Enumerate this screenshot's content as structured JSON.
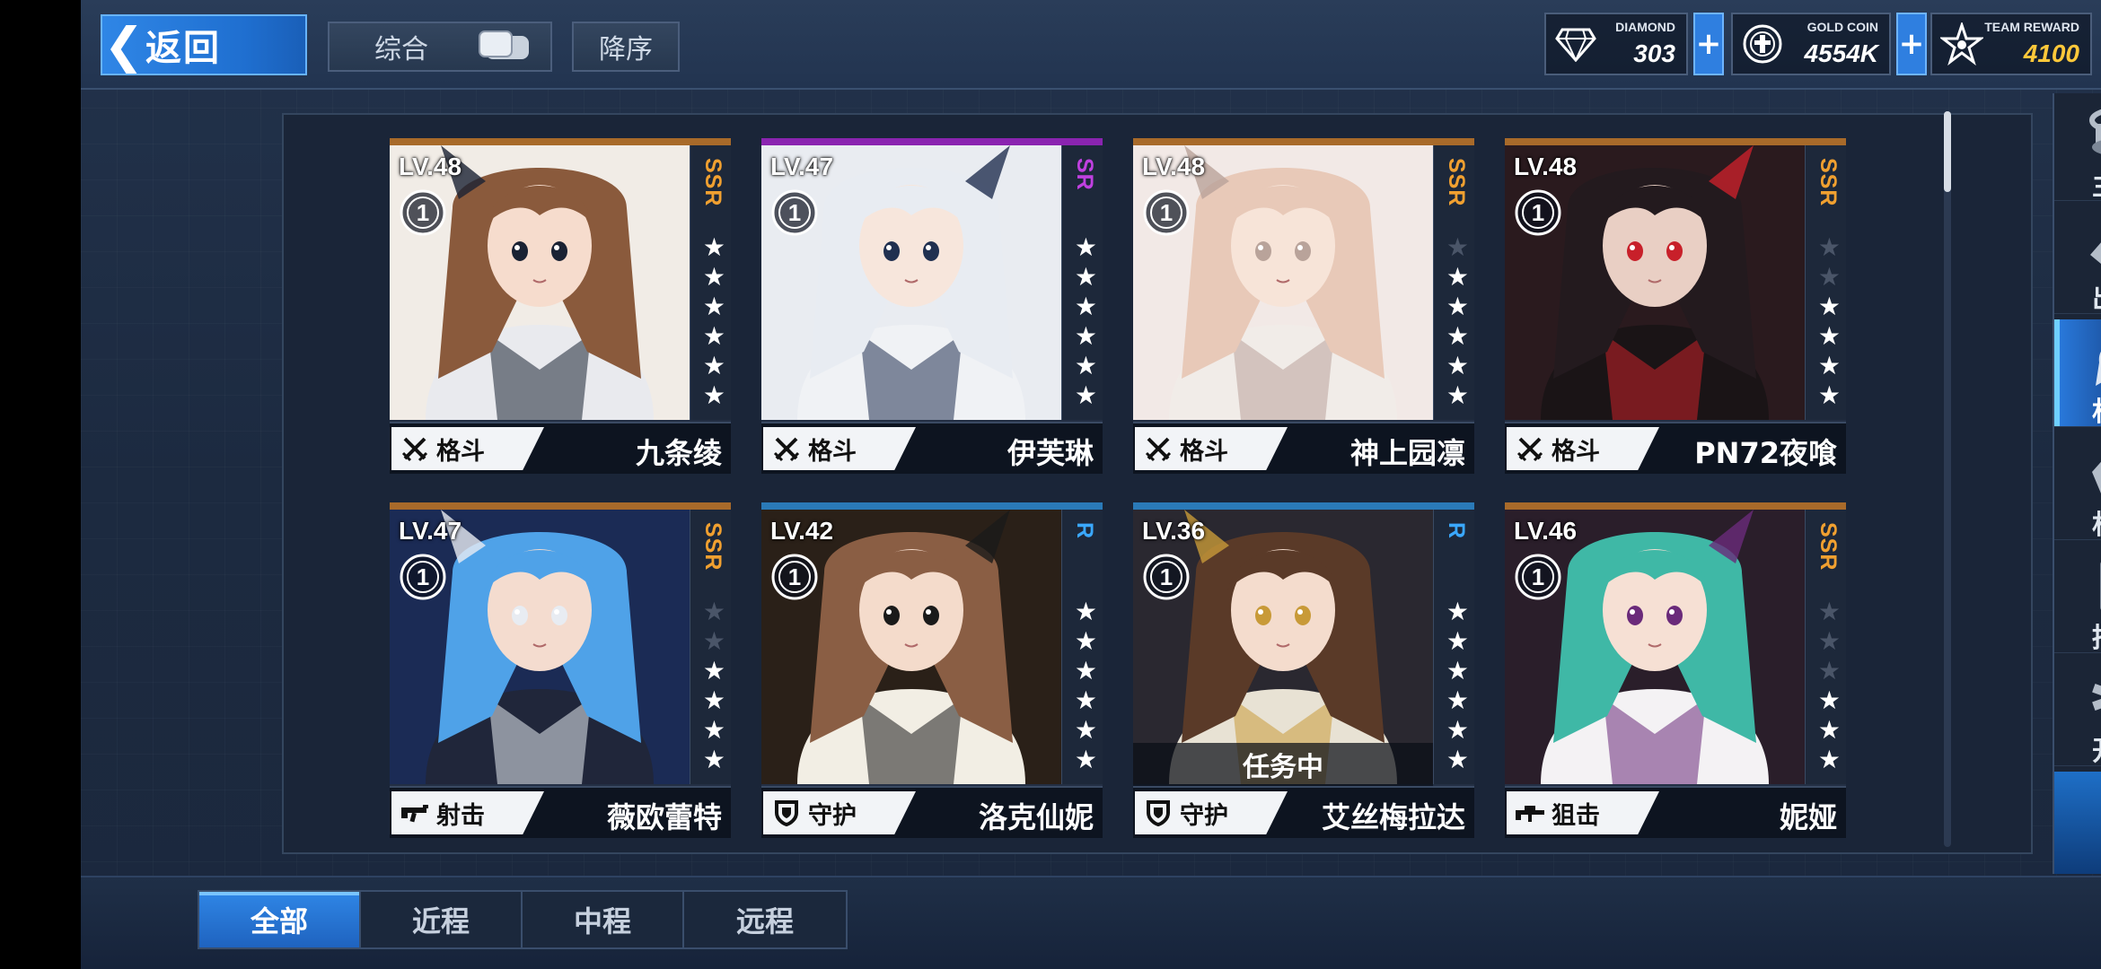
{
  "header": {
    "back_label": "返回",
    "sort_label": "综合",
    "order_label": "降序"
  },
  "resources": {
    "diamond": {
      "label": "DIAMOND",
      "value": "303"
    },
    "gold": {
      "label": "GOLD COIN",
      "value": "4554K"
    },
    "team": {
      "label": "TEAM REWARD",
      "value": "4100"
    },
    "plus": "+"
  },
  "colors": {
    "accent_blue": "#2f86e6",
    "ssr": "#f0a030",
    "sr": "#c040e0",
    "r": "#3aa8ff",
    "ssr_bar": "#a86a2a",
    "sr_bar": "#8a24b0",
    "r_bar": "#2a7ab8"
  },
  "cards": [
    {
      "level": "LV.48",
      "rank": "1",
      "rarity": "SSR",
      "stars": 6,
      "role": "格斗",
      "role_icon": "crossed-swords-icon",
      "name": "九条绫",
      "mission": ""
    },
    {
      "level": "LV.47",
      "rank": "1",
      "rarity": "SR",
      "stars": 6,
      "role": "格斗",
      "role_icon": "crossed-swords-icon",
      "name": "伊芙琳",
      "mission": ""
    },
    {
      "level": "LV.48",
      "rank": "1",
      "rarity": "SSR",
      "stars": 5,
      "role": "格斗",
      "role_icon": "crossed-swords-icon",
      "name": "神上园凛",
      "mission": ""
    },
    {
      "level": "LV.48",
      "rank": "1",
      "rarity": "SSR",
      "stars": 4,
      "role": "格斗",
      "role_icon": "crossed-swords-icon",
      "name": "PN72夜喰",
      "mission": ""
    },
    {
      "level": "LV.47",
      "rank": "1",
      "rarity": "SSR",
      "stars": 4,
      "role": "射击",
      "role_icon": "rifle-icon",
      "name": "薇欧蕾特",
      "mission": ""
    },
    {
      "level": "LV.42",
      "rank": "1",
      "rarity": "R",
      "stars": 6,
      "role": "守护",
      "role_icon": "shield-icon",
      "name": "洛克仙妮",
      "mission": ""
    },
    {
      "level": "LV.36",
      "rank": "1",
      "rarity": "R",
      "stars": 6,
      "role": "守护",
      "role_icon": "shield-icon",
      "name": "艾丝梅拉达",
      "mission": "任务中"
    },
    {
      "level": "LV.46",
      "rank": "1",
      "rarity": "SSR",
      "stars": 3,
      "role": "狙击",
      "role_icon": "sniper-rifle-icon",
      "name": "妮娅",
      "mission": ""
    }
  ],
  "sidebar": [
    {
      "label": "主厅",
      "icon": "hall-icon"
    },
    {
      "label": "出战",
      "icon": "mech-deploy-icon"
    },
    {
      "label": "机师",
      "icon": "pilot-icon",
      "active": true
    },
    {
      "label": "机库",
      "icon": "hangar-icon"
    },
    {
      "label": "招募",
      "icon": "recruit-card-icon"
    },
    {
      "label": "开发",
      "icon": "develop-wrench-icon"
    }
  ],
  "tabs": [
    {
      "label": "全部",
      "active": true
    },
    {
      "label": "近程"
    },
    {
      "label": "中程"
    },
    {
      "label": "远程"
    }
  ]
}
